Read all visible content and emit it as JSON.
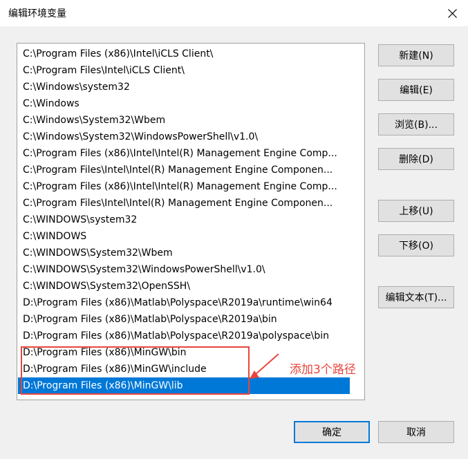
{
  "window": {
    "title": "编辑环境变量",
    "close_icon": "close-icon"
  },
  "path_list": {
    "items": [
      {
        "label": "C:\\Program Files (x86)\\Intel\\iCLS Client\\"
      },
      {
        "label": "C:\\Program Files\\Intel\\iCLS Client\\"
      },
      {
        "label": "C:\\Windows\\system32"
      },
      {
        "label": "C:\\Windows"
      },
      {
        "label": "C:\\Windows\\System32\\Wbem"
      },
      {
        "label": "C:\\Windows\\System32\\WindowsPowerShell\\v1.0\\"
      },
      {
        "label": "C:\\Program Files (x86)\\Intel\\Intel(R) Management Engine Comp..."
      },
      {
        "label": "C:\\Program Files\\Intel\\Intel(R) Management Engine Componen..."
      },
      {
        "label": "C:\\Program Files (x86)\\Intel\\Intel(R) Management Engine Comp..."
      },
      {
        "label": "C:\\Program Files\\Intel\\Intel(R) Management Engine Componen..."
      },
      {
        "label": "C:\\WINDOWS\\system32"
      },
      {
        "label": "C:\\WINDOWS"
      },
      {
        "label": "C:\\WINDOWS\\System32\\Wbem"
      },
      {
        "label": "C:\\WINDOWS\\System32\\WindowsPowerShell\\v1.0\\"
      },
      {
        "label": "C:\\WINDOWS\\System32\\OpenSSH\\"
      },
      {
        "label": "D:\\Program Files (x86)\\Matlab\\Polyspace\\R2019a\\runtime\\win64"
      },
      {
        "label": "D:\\Program Files (x86)\\Matlab\\Polyspace\\R2019a\\bin"
      },
      {
        "label": "D:\\Program Files (x86)\\Matlab\\Polyspace\\R2019a\\polyspace\\bin"
      },
      {
        "label": "D:\\Program Files (x86)\\MinGW\\bin"
      },
      {
        "label": "D:\\Program Files (x86)\\MinGW\\include"
      },
      {
        "label": "D:\\Program Files (x86)\\MinGW\\lib",
        "selected": true
      }
    ]
  },
  "buttons": {
    "new": "新建(N)",
    "edit": "编辑(E)",
    "browse": "浏览(B)...",
    "delete": "删除(D)",
    "move_up": "上移(U)",
    "move_down": "下移(O)",
    "edit_text": "编辑文本(T)...",
    "ok": "确定",
    "cancel": "取消"
  },
  "annotation": {
    "text": "添加3个路径",
    "color": "#e8453c"
  },
  "colors": {
    "selection": "#0078d7",
    "dialog_bg": "#f0f0f0"
  }
}
